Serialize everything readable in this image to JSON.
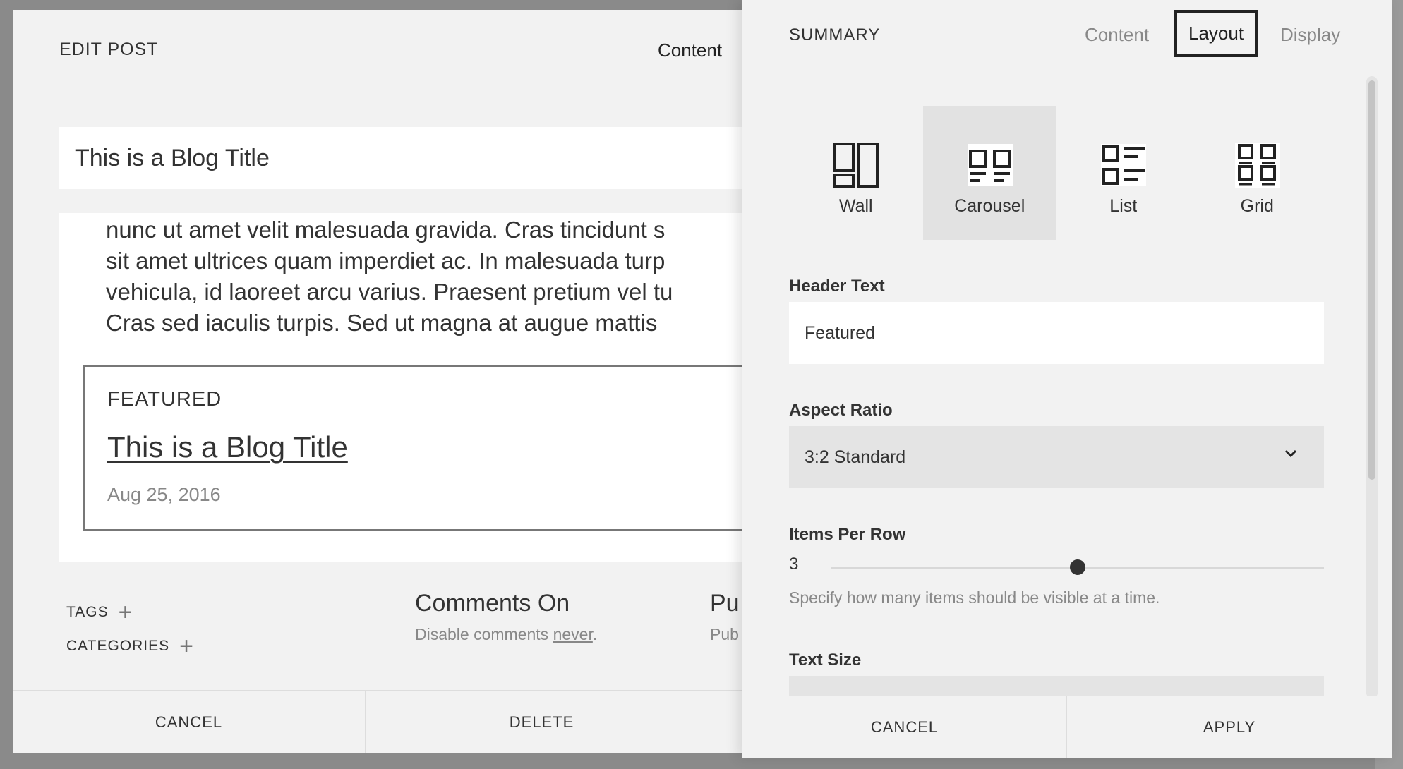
{
  "edit_post": {
    "title": "EDIT POST",
    "tab_content": "Content",
    "post_title": "This is a Blog Title",
    "body_lines": [
      "nunc ut amet velit malesuada gravida. Cras tincidunt s",
      "sit amet ultrices quam imperdiet ac. In malesuada turp",
      "vehicula, id laoreet arcu varius. Praesent pretium vel tu",
      "Cras sed iaculis turpis. Sed ut magna at augue mattis"
    ],
    "featured": {
      "label": "FEATURED",
      "post_title": "This is a Blog Title",
      "date": "Aug 25, 2016"
    },
    "tags_label": "TAGS",
    "categories_label": "CATEGORIES",
    "plus": "+",
    "comments": {
      "title": "Comments On",
      "sub_prefix": "Disable comments ",
      "sub_link": "never",
      "sub_suffix": "."
    },
    "publish": {
      "title": "Pu",
      "sub": "Pub"
    },
    "footer": {
      "cancel": "CANCEL",
      "delete": "DELETE"
    }
  },
  "summary": {
    "title": "SUMMARY",
    "tabs": [
      {
        "label": "Content",
        "active": false
      },
      {
        "label": "Layout",
        "active": true
      },
      {
        "label": "Display",
        "active": false
      }
    ],
    "layouts": [
      {
        "label": "Wall",
        "icon": "wall-layout-icon",
        "selected": false
      },
      {
        "label": "Carousel",
        "icon": "carousel-layout-icon",
        "selected": true
      },
      {
        "label": "List",
        "icon": "list-layout-icon",
        "selected": false
      },
      {
        "label": "Grid",
        "icon": "grid-layout-icon",
        "selected": false
      }
    ],
    "header_text": {
      "label": "Header Text",
      "value": "Featured"
    },
    "aspect_ratio": {
      "label": "Aspect Ratio",
      "value": "3:2 Standard",
      "icon": "chevron-down-icon"
    },
    "items_per_row": {
      "label": "Items Per Row",
      "value": "3",
      "level": 0.5,
      "help": "Specify how many items should be visible at a time."
    },
    "text_size": {
      "label": "Text Size"
    },
    "footer": {
      "cancel": "CANCEL",
      "apply": "APPLY"
    }
  }
}
